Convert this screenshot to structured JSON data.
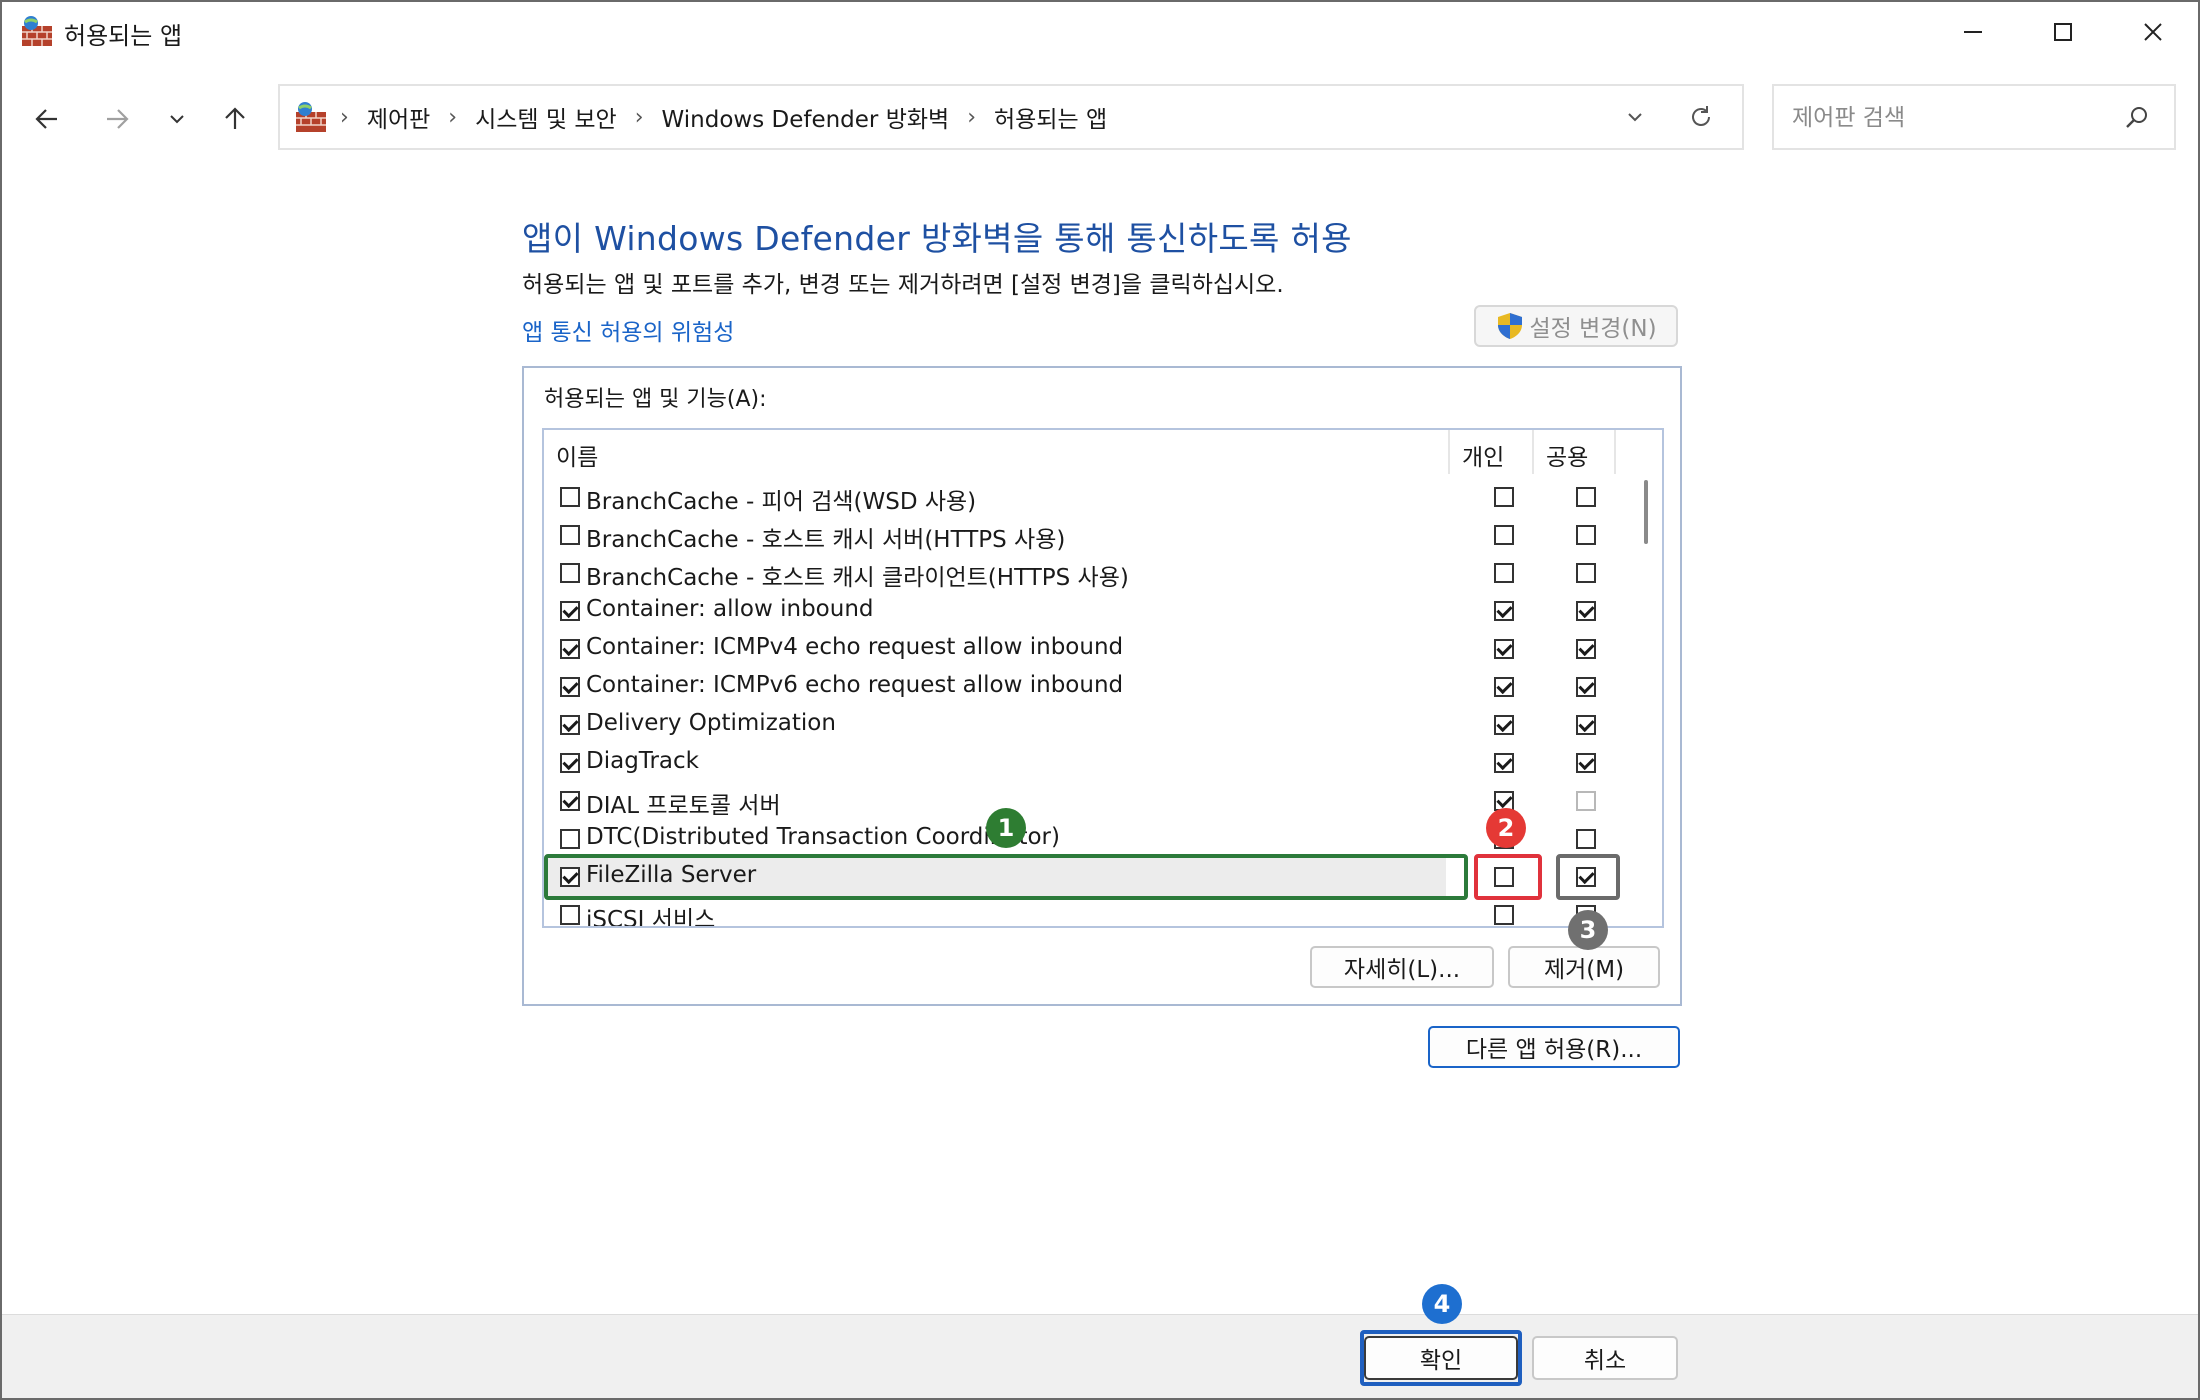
{
  "window": {
    "title": "허용되는 앱",
    "controls": {
      "minimize": "minimize-icon",
      "maximize": "maximize-icon",
      "close": "close-icon"
    }
  },
  "nav": {
    "back": "back-arrow-icon",
    "forward": "forward-arrow-icon",
    "recent": "chevron-down-icon",
    "up": "up-arrow-icon",
    "breadcrumb": [
      "제어판",
      "시스템 및 보안",
      "Windows Defender 방화벽",
      "허용되는 앱"
    ],
    "search_placeholder": "제어판 검색"
  },
  "main": {
    "heading": "앱이 Windows Defender 방화벽을 통해 통신하도록 허용",
    "subtitle": "허용되는 앱 및 포트를 추가, 변경 또는 제거하려면 [설정 변경]을 클릭하십시오.",
    "risk_link": "앱 통신 허용의 위험성",
    "change_settings": "설정 변경(N)",
    "group_label": "허용되는 앱 및 기능(A):",
    "columns": {
      "name": "이름",
      "private": "개인",
      "public": "공용"
    },
    "rows": [
      {
        "name": "BranchCache - 피어 검색(WSD 사용)",
        "enabled": false,
        "private": false,
        "public": false
      },
      {
        "name": "BranchCache - 호스트 캐시 서버(HTTPS 사용)",
        "enabled": false,
        "private": false,
        "public": false
      },
      {
        "name": "BranchCache - 호스트 캐시 클라이언트(HTTPS 사용)",
        "enabled": false,
        "private": false,
        "public": false
      },
      {
        "name": "Container: allow inbound",
        "enabled": true,
        "private": true,
        "public": true
      },
      {
        "name": "Container: ICMPv4 echo request allow inbound",
        "enabled": true,
        "private": true,
        "public": true
      },
      {
        "name": "Container: ICMPv6 echo request allow inbound",
        "enabled": true,
        "private": true,
        "public": true
      },
      {
        "name": "Delivery Optimization",
        "enabled": true,
        "private": true,
        "public": true
      },
      {
        "name": "DiagTrack",
        "enabled": true,
        "private": true,
        "public": true
      },
      {
        "name": "DIAL 프로토콜 서버",
        "enabled": true,
        "private": true,
        "public": false
      },
      {
        "name": "DTC(Distributed Transaction Coordinator)",
        "enabled": false,
        "private": false,
        "public": false
      },
      {
        "name": "FileZilla Server",
        "enabled": true,
        "private": false,
        "public": true
      },
      {
        "name": "iSCSI 서비스",
        "enabled": false,
        "private": false,
        "public": false
      }
    ],
    "details_button": "자세히(L)...",
    "remove_button": "제거(M)",
    "allow_other_button": "다른 앱 허용(R)..."
  },
  "footer": {
    "ok": "확인",
    "cancel": "취소"
  },
  "annotations": [
    "1",
    "2",
    "3",
    "4"
  ],
  "colors": {
    "heading": "#1e50a2",
    "link": "#1a64c8",
    "annotation_green": "#2e7d32",
    "annotation_red": "#e53935",
    "annotation_gray": "#707070",
    "annotation_blue": "#1e6fd0"
  }
}
